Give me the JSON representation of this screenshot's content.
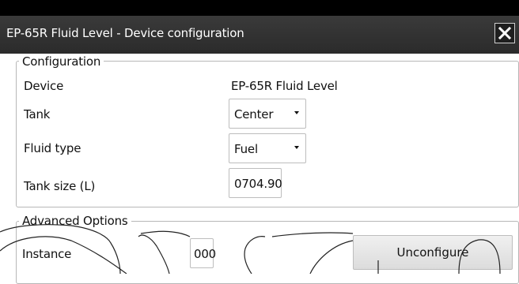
{
  "window": {
    "title": "EP-65R Fluid Level - Device configuration"
  },
  "icons": {
    "close": "close-icon",
    "dropdown": "chevron-down-icon"
  },
  "configuration": {
    "legend": "Configuration",
    "device_label": "Device",
    "device_value": "EP-65R Fluid Level",
    "tank_label": "Tank",
    "tank_value": "Center",
    "fluid_type_label": "Fluid type",
    "fluid_type_value": "Fuel",
    "tank_size_label": "Tank size (L)",
    "tank_size_value": "0704.90"
  },
  "advanced": {
    "legend": "Advanced Options",
    "instance_label": "Instance",
    "instance_value": "000",
    "unconfigure_label": "Unconfigure"
  }
}
